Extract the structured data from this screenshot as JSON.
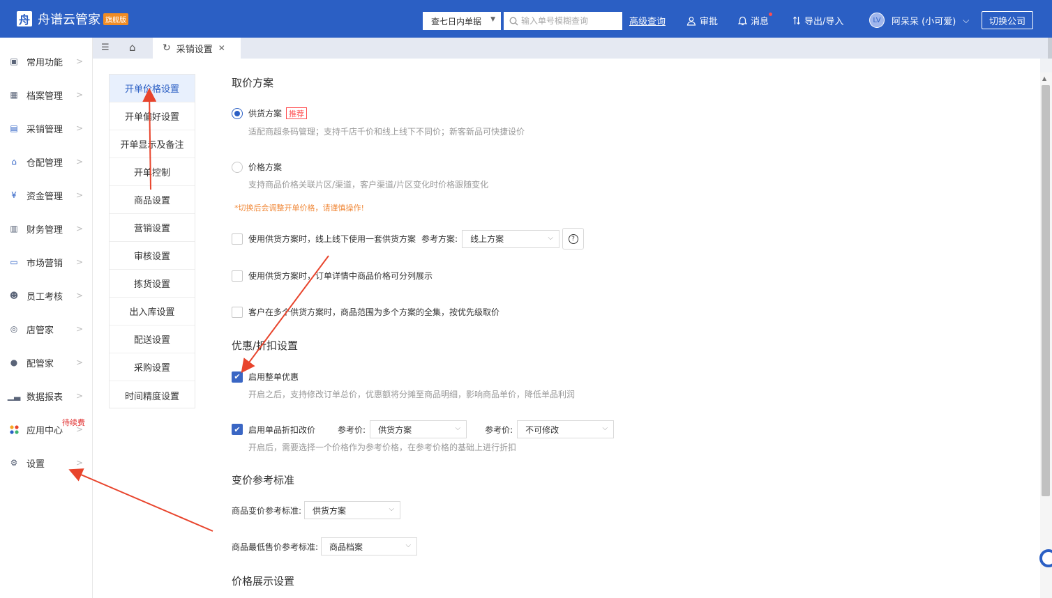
{
  "header": {
    "app_name": "舟谱云管家",
    "edition_badge": "旗舰版",
    "filter_value": "查七日内单据",
    "search_placeholder": "输入单号模糊查询",
    "advanced_query": "高级查询",
    "approve": "审批",
    "messages": "消息",
    "import_export": "导出/导入",
    "user_name": "阿呆呆 (小可爱)",
    "switch_company": "切换公司"
  },
  "sidebar": {
    "items": [
      {
        "label": "常用功能",
        "icon": "doc-icon"
      },
      {
        "label": "档案管理",
        "icon": "grid-icon"
      },
      {
        "label": "采销管理",
        "icon": "clipboard-icon"
      },
      {
        "label": "仓配管理",
        "icon": "warehouse-icon"
      },
      {
        "label": "资金管理",
        "icon": "money-icon"
      },
      {
        "label": "财务管理",
        "icon": "calculator-icon"
      },
      {
        "label": "市场营销",
        "icon": "store-icon"
      },
      {
        "label": "员工考核",
        "icon": "people-icon"
      },
      {
        "label": "店管家",
        "icon": "shop-icon"
      },
      {
        "label": "配管家",
        "icon": "chat-icon"
      },
      {
        "label": "数据报表",
        "icon": "chart-icon"
      },
      {
        "label": "应用中心",
        "icon": "apps-icon"
      },
      {
        "label": "设置",
        "icon": "gear-icon"
      }
    ],
    "due_tag": "待续费"
  },
  "tabs": {
    "active_label": "采销设置"
  },
  "submenu": {
    "items": [
      "开单价格设置",
      "开单偏好设置",
      "开单显示及备注",
      "开单控制",
      "商品设置",
      "营销设置",
      "审核设置",
      "拣货设置",
      "出入库设置",
      "配送设置",
      "采购设置",
      "时间精度设置"
    ]
  },
  "main": {
    "pricing_title": "取价方案",
    "supply_plan": "供货方案",
    "recommend_tag": "推荐",
    "supply_desc": "适配商超条码管理；支持千店千价和线上线下不同价；新客新品可快捷设价",
    "price_plan": "价格方案",
    "price_desc": "支持商品价格关联片区/渠道，客户渠道/片区变化时价格跟随变化",
    "warning": "*切换后会调整开单价格，请谨慎操作!",
    "opt1": "使用供货方案时，线上线下使用一套供货方案",
    "ref_plan_label": "参考方案:",
    "ref_plan_value": "线上方案",
    "opt2": "使用供货方案时，订单详情中商品价格可分列展示",
    "opt3": "客户在多个供货方案时，商品范围为多个方案的全集，按优先级取价",
    "discount_title": "优惠/折扣设置",
    "whole_discount": "启用整单优惠",
    "whole_discount_desc": "开启之后，支持修改订单总价，优惠额将分摊至商品明细，影响商品单价，降低单品利润",
    "single_discount": "启用单品折扣改价",
    "ref_price_label": "参考价:",
    "ref_price_value": "供货方案",
    "ref_price_label2": "参考价:",
    "ref_price_value2": "不可修改",
    "single_discount_desc": "开启后，需要选择一个价格作为参考价格，在参考价格的基础上进行折扣",
    "change_title": "变价参考标准",
    "change_label": "商品变价参考标准:",
    "change_value": "供货方案",
    "min_price_label": "商品最低售价参考标准:",
    "min_price_value": "商品档案",
    "display_title": "价格展示设置"
  },
  "colors": {
    "brand": "#2b5fc4",
    "annotation": "#e8442c",
    "warning": "#f0893a"
  }
}
